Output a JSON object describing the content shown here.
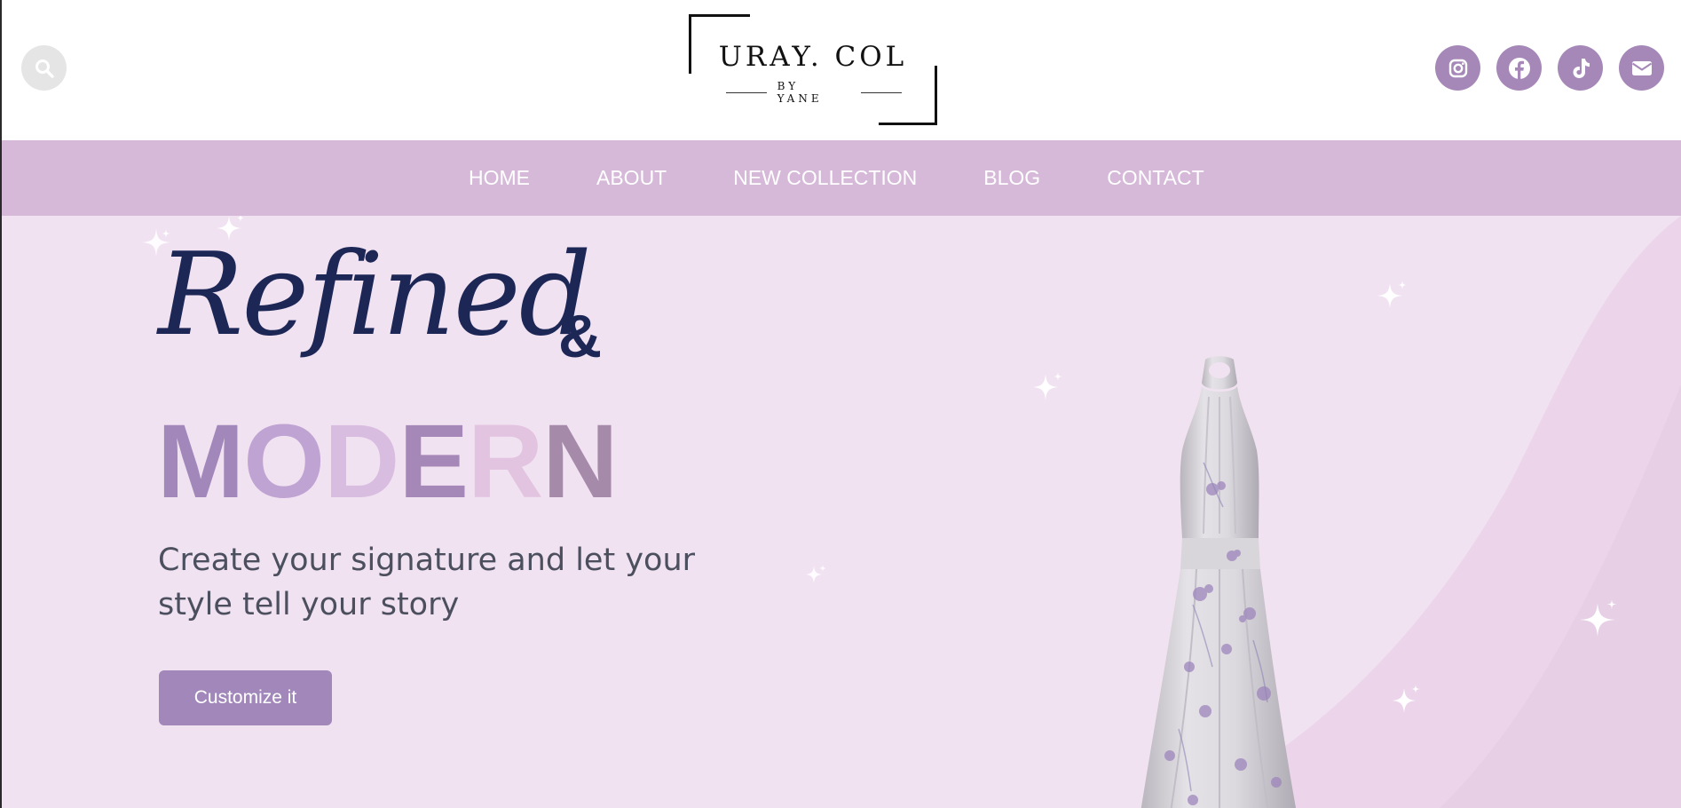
{
  "header": {
    "search_icon": "search-icon",
    "logo": {
      "name": "URAY. COL",
      "tagline": "BY YANE"
    },
    "socials": [
      {
        "icon": "instagram-icon",
        "label": "Instagram"
      },
      {
        "icon": "facebook-icon",
        "label": "Facebook"
      },
      {
        "icon": "tiktok-icon",
        "label": "TikTok"
      },
      {
        "icon": "envelope-icon",
        "label": "Email"
      }
    ]
  },
  "nav": {
    "items": [
      "HOME",
      "ABOUT",
      "NEW COLLECTION",
      "BLOG",
      "CONTACT"
    ]
  },
  "hero": {
    "headline_script": "Refined",
    "headline_amp": "&",
    "headline_word": {
      "letters": [
        "M",
        "O",
        "D",
        "E",
        "R",
        "N"
      ],
      "colors": [
        "#a287ba",
        "#bfa3d2",
        "#d9bde0",
        "#a688b8",
        "#e2c3e0",
        "#a68aaa"
      ]
    },
    "subtitle": "Create your signature and let your style tell your story",
    "cta_label": "Customize it",
    "image": "floral-halter-dress"
  },
  "colors": {
    "nav_bg": "#d6b9d9",
    "hero_bg": "#f1e2f2",
    "accent": "#a287ba",
    "headline": "#1d2756"
  }
}
